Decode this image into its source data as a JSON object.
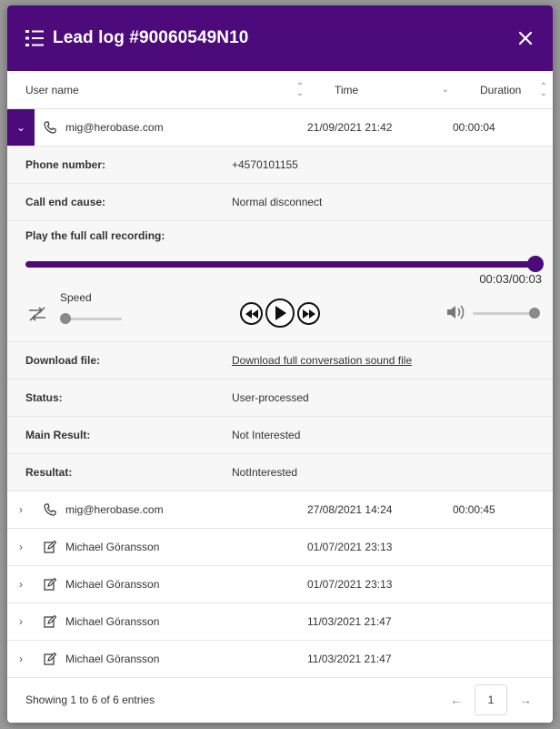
{
  "modal": {
    "title": "Lead log #90060549N10",
    "close_icon": "close-icon",
    "header_icon": "list-icon",
    "accent": "#4d0a7a"
  },
  "columns": {
    "user": "User name",
    "time": "Time",
    "duration": "Duration"
  },
  "expanded": {
    "user": "mig@herobase.com",
    "time": "21/09/2021 21:42",
    "duration": "00:00:04",
    "icon": "phone-icon",
    "details": {
      "phone_label": "Phone number:",
      "phone_value": "+4570101155",
      "end_label": "Call end cause:",
      "end_value": "Normal disconnect",
      "recording_label": "Play the full call recording:",
      "time_readout": "00:03/00:03",
      "progress": 1.0,
      "speed_label": "Speed",
      "speed_level": 0,
      "volume_level": 1.0,
      "download_label": "Download file:",
      "download_link": "Download full conversation sound file",
      "status_label": "Status:",
      "status_value": "User-processed",
      "main_result_label": "Main Result:",
      "main_result_value": "Not Interested",
      "resultat_label": "Resultat:",
      "resultat_value": "NotInterested"
    }
  },
  "rows": [
    {
      "user": "mig@herobase.com",
      "time": "27/08/2021 14:24",
      "duration": "00:00:45",
      "icon": "phone-icon"
    },
    {
      "user": "Michael Göransson",
      "time": "01/07/2021 23:13",
      "duration": "",
      "icon": "edit-icon"
    },
    {
      "user": "Michael Göransson",
      "time": "01/07/2021 23:13",
      "duration": "",
      "icon": "edit-icon"
    },
    {
      "user": "Michael Göransson",
      "time": "11/03/2021 21:47",
      "duration": "",
      "icon": "edit-icon"
    },
    {
      "user": "Michael Göransson",
      "time": "11/03/2021 21:47",
      "duration": "",
      "icon": "edit-icon"
    }
  ],
  "footer": {
    "summary": "Showing 1 to 6 of 6 entries",
    "page": "1",
    "prev": "←",
    "next": "→"
  }
}
